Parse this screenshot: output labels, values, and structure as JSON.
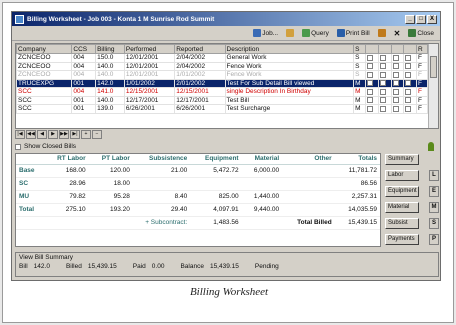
{
  "window": {
    "title": "Billing Worksheet - Job 003 - Konta 1 M Sunrise Rod Summit",
    "minimize": "_",
    "maximize": "□",
    "close": "X"
  },
  "toolbar": {
    "items": [
      {
        "label": "Job...",
        "icon": "job-icon",
        "color": "#3a6bb5"
      },
      {
        "label": "",
        "icon": "save-icon",
        "color": "#d2a03c"
      },
      {
        "label": "Query",
        "icon": "query-icon",
        "color": "#4a9a4a"
      },
      {
        "label": "Print Bill",
        "icon": "print-icon",
        "color": "#2a5fa8"
      },
      {
        "label": "",
        "icon": "copy-icon",
        "color": "#c07a1a"
      },
      {
        "label": "",
        "icon": "delete-icon",
        "color": "#444444"
      },
      {
        "label": "Close",
        "icon": "close-door-icon",
        "color": "#3a7a3a"
      }
    ]
  },
  "bills_grid": {
    "headers": [
      "Company",
      "CCS",
      "Billing",
      "Performed",
      "Reported",
      "Description",
      "S",
      "",
      "",
      "",
      "",
      "R"
    ],
    "rows": [
      {
        "company": "ZCNCEOO",
        "ccs": "004",
        "billing": "150.0",
        "performed": "12/01/2001",
        "reported": "2/04/2002",
        "description": "General Work",
        "s": "S",
        "r": "F",
        "style": "normal"
      },
      {
        "company": "ZCNCEOO",
        "ccs": "004",
        "billing": "140.0",
        "performed": "12/01/2001",
        "reported": "2/04/2002",
        "description": "Fence Work",
        "s": "S",
        "r": "F",
        "style": "normal"
      },
      {
        "company": "ZCNCEOO",
        "ccs": "004",
        "billing": "140.0",
        "performed": "12/01/2001",
        "reported": "1/01/2002",
        "description": "Fence Work",
        "s": "S",
        "r": "F",
        "style": "gray"
      },
      {
        "company": "TRUCEXPG",
        "ccs": "001",
        "billing": "142.0",
        "performed": "1/01/2002",
        "reported": "2/01/2002",
        "description": "Test For Sub Detail Bill viewed",
        "s": "M",
        "r": "F",
        "style": "sel"
      },
      {
        "company": "SCC",
        "ccs": "004",
        "billing": "141.0",
        "performed": "12/15/2001",
        "reported": "12/15/2001",
        "description": "single Description In Birthday",
        "s": "M",
        "r": "F",
        "style": "red"
      },
      {
        "company": "SCC",
        "ccs": "001",
        "billing": "140.0",
        "performed": "12/17/2001",
        "reported": "12/17/2001",
        "description": "Test Bill",
        "s": "M",
        "r": "F",
        "style": "normal"
      },
      {
        "company": "SCC",
        "ccs": "001",
        "billing": "139.0",
        "performed": "6/26/2001",
        "reported": "6/26/2001",
        "description": "Test Surcharge",
        "s": "M",
        "r": "F",
        "style": "normal"
      }
    ]
  },
  "navigator": [
    "|◀",
    "◀◀",
    "◀",
    "▶",
    "▶▶",
    "▶|",
    "+",
    "−"
  ],
  "show_closed_label": "Show Closed Bills",
  "totals_grid": {
    "headers": [
      "",
      "RT Labor",
      "PT Labor",
      "Subsistence",
      "Equipment",
      "Material",
      "Other",
      "Totals"
    ],
    "rows": [
      {
        "name": "Base",
        "cells": [
          "168.00",
          "120.00",
          "21.00",
          "5,472.72",
          "6,000.00",
          "",
          "11,781.72"
        ]
      },
      {
        "name": "SC",
        "cells": [
          "28.96",
          "18.00",
          "",
          "",
          "",
          "",
          "86.56"
        ]
      },
      {
        "name": "MU",
        "cells": [
          "79.82",
          "95.28",
          "8.40",
          "825.00",
          "1,440.00",
          "",
          "2,257.31"
        ]
      },
      {
        "name": "Total",
        "cells": [
          "275.10",
          "193.20",
          "29.40",
          "4,097.91",
          "9,440.00",
          "",
          "14,035.59"
        ]
      }
    ],
    "subcontract_label": "+ Subcontract:",
    "subcontract_value": "1,483.56",
    "total_billed_label": "Total Billed",
    "total_billed_value": "15,439.15"
  },
  "side_buttons": [
    {
      "label": "Summary",
      "key": ""
    },
    {
      "label": "Labor",
      "key": "L"
    },
    {
      "label": "Equipment",
      "key": "E"
    },
    {
      "label": "Material",
      "key": "M"
    },
    {
      "label": "Subsist",
      "key": "S"
    },
    {
      "label": "Payments",
      "key": "P"
    }
  ],
  "summary": {
    "title": "View Bill Summary",
    "bill_label": "Bill",
    "bill_value": "142.0",
    "billed_label": "Billed",
    "billed_value": "15,439.15",
    "paid_label": "Paid",
    "paid_value": "0.00",
    "balance_label": "Balance",
    "balance_value": "15,439.15",
    "status_value": "Pending"
  },
  "caption": "Billing Worksheet"
}
